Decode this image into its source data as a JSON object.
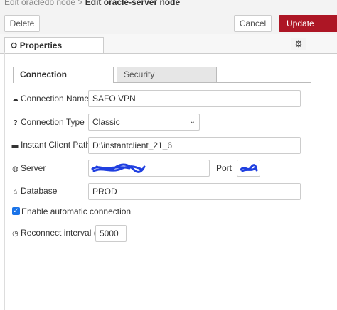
{
  "header": {
    "breadcrumb_parent": "Edit oracledb node > ",
    "breadcrumb_current": "Edit oracle-server node",
    "delete_label": "Delete",
    "cancel_label": "Cancel",
    "update_label": "Update"
  },
  "properties_tab": {
    "label": "Properties",
    "icon": "gear-icon"
  },
  "tabs": [
    {
      "label": "Connection",
      "active": true
    },
    {
      "label": "Security",
      "active": false
    }
  ],
  "form": {
    "connection_name": {
      "label": "Connection Name",
      "icon": "cloud-icon",
      "value": "SAFO VPN"
    },
    "connection_type": {
      "label": "Connection Type",
      "icon": "question-icon",
      "value": "Classic"
    },
    "instant_client_path": {
      "label": "Instant Client Path",
      "icon": "folder-icon",
      "value": "D:\\instantclient_21_6"
    },
    "server": {
      "label": "Server",
      "icon": "globe-icon",
      "value": "",
      "port_label": "Port",
      "port_value": ""
    },
    "database": {
      "label": "Database",
      "icon": "home-icon",
      "value": "PROD"
    },
    "auto_connect": {
      "label": "Enable automatic connection",
      "checked": true
    },
    "reconnect_interval": {
      "label": "Reconnect interval (ms)",
      "icon": "clock-icon",
      "value": "5000"
    }
  },
  "colors": {
    "update_button": "#ad1625",
    "checkbox": "#1a73e8",
    "redaction_scribble": "#1f3fe0"
  }
}
